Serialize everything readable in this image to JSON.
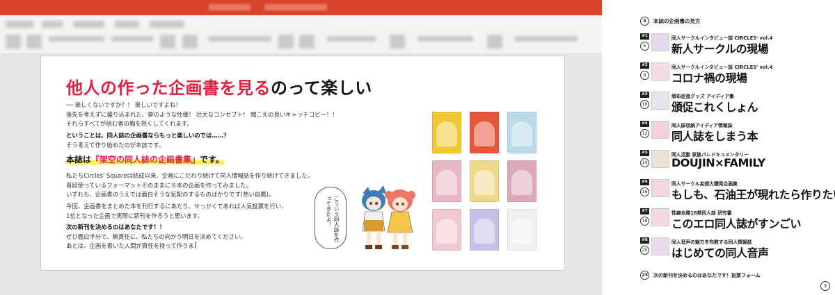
{
  "colors": {
    "titlebar": "#d9442a",
    "accent_red": "#e02040",
    "highlight_yellow": "#fff24a"
  },
  "slide": {
    "headline_red": "他人の作った企画書を見る",
    "headline_black": "のって楽しい",
    "intro_lines": [
      "── 楽しくないですか？！ 楽しいですよね！",
      "後先を考えずに盛り込まれた、夢のような仕様！ 壮大なコンセプト！ 聞こえの良いキャッチコピー！！",
      "それらすべてが読む者の胸を熱くしてくれます。"
    ],
    "question_bold": "ということは、同人誌の企画書ならもっと楽しいのでは……？",
    "question_line": "そう考えて作り始めたのが本誌です。",
    "yellow_prefix": "本誌は",
    "yellow_highlight": "『架空の同人誌の企画書集』",
    "yellow_suffix": "です。",
    "story_lines": [
      "私たちCircles' Squareは結成以来、企画にこだわり続けて同人情報誌を作り続けてきました。",
      "普段使っているフォーマットそのままに８本の企画を作ってみました。",
      "いずれも、企画書のうえでは面白そうな気配のするものばかりです(熱い自薦)。"
    ],
    "plan_lines": [
      "今回、企画書をまとめた本を刊行するにあたり、せっかくであれば人気投票を行い、",
      "1位となった企画で実際に新刊を作ろうと思います。"
    ],
    "decide_bold": "次の新刊を決めるのはあなたです！！",
    "decide_lines": [
      "ぜひ面白半分で、無責任に、私たちの向かう明日を決めてください。",
      "あとは、企画を書いた人間が責任を持って作りま"
    ],
    "speech_bubble": "こういう同人誌を作ってきたよ！",
    "thumb_colors": [
      "#f0c830",
      "#e8553a",
      "#b9dbe9",
      "#eab8c4",
      "#f0d88a",
      "#dfa8b8",
      "#f1c8d0",
      "#c8c0e8",
      "#f2f0ee"
    ]
  },
  "toc": {
    "header_page": "4",
    "header_title": "本誌の企画書の見方",
    "entries": [
      {
        "num": "#1",
        "page": "6",
        "sub": "同人サークルインタビュー誌 CIRCLES' vol.4",
        "title": "新人サークルの現場",
        "thumb": "#e6d8ef"
      },
      {
        "num": "#2",
        "page": "8",
        "sub": "同人サークルインタビュー誌 CIRCLES' vol.4",
        "title": "コロナ禍の現場",
        "thumb": "#f2dbe3"
      },
      {
        "num": "#3",
        "page": "10",
        "sub": "頒布促進グッズ アイディア集",
        "title": "頒促これくしょん",
        "thumb": "#e3e6ee"
      },
      {
        "num": "#4",
        "page": "12",
        "sub": "同人誌収納アイディア情報誌",
        "title": "同人誌をしまう本",
        "thumb": "#f3d2d8"
      },
      {
        "num": "#5",
        "page": "14",
        "sub": "同人活動 家族バレドキュメンタリー",
        "title": "DOUJIN×FAMILY",
        "thumb": "#efe1d3"
      },
      {
        "num": "#6",
        "page": "16",
        "sub": "同人サークル妄想大爆発企画集",
        "title": "もしも、石油王が現れたら作りたい同人誌",
        "thumb": "#f1d7de"
      },
      {
        "num": "#7",
        "page": "18",
        "sub": "性癖全開18禁同人誌 研究書",
        "title": "このエロ同人誌がすンごい",
        "thumb": "#f3d9dc"
      },
      {
        "num": "#8",
        "page": "20",
        "sub": "同人音声の魅力を布教する同人情報誌",
        "title": "はじめての同人音声",
        "thumb": "#e9dcef"
      }
    ],
    "final_page": "23",
    "final_label": "次の新刊を決めるのはあなたです！投票フォーム",
    "page_number": "3"
  }
}
